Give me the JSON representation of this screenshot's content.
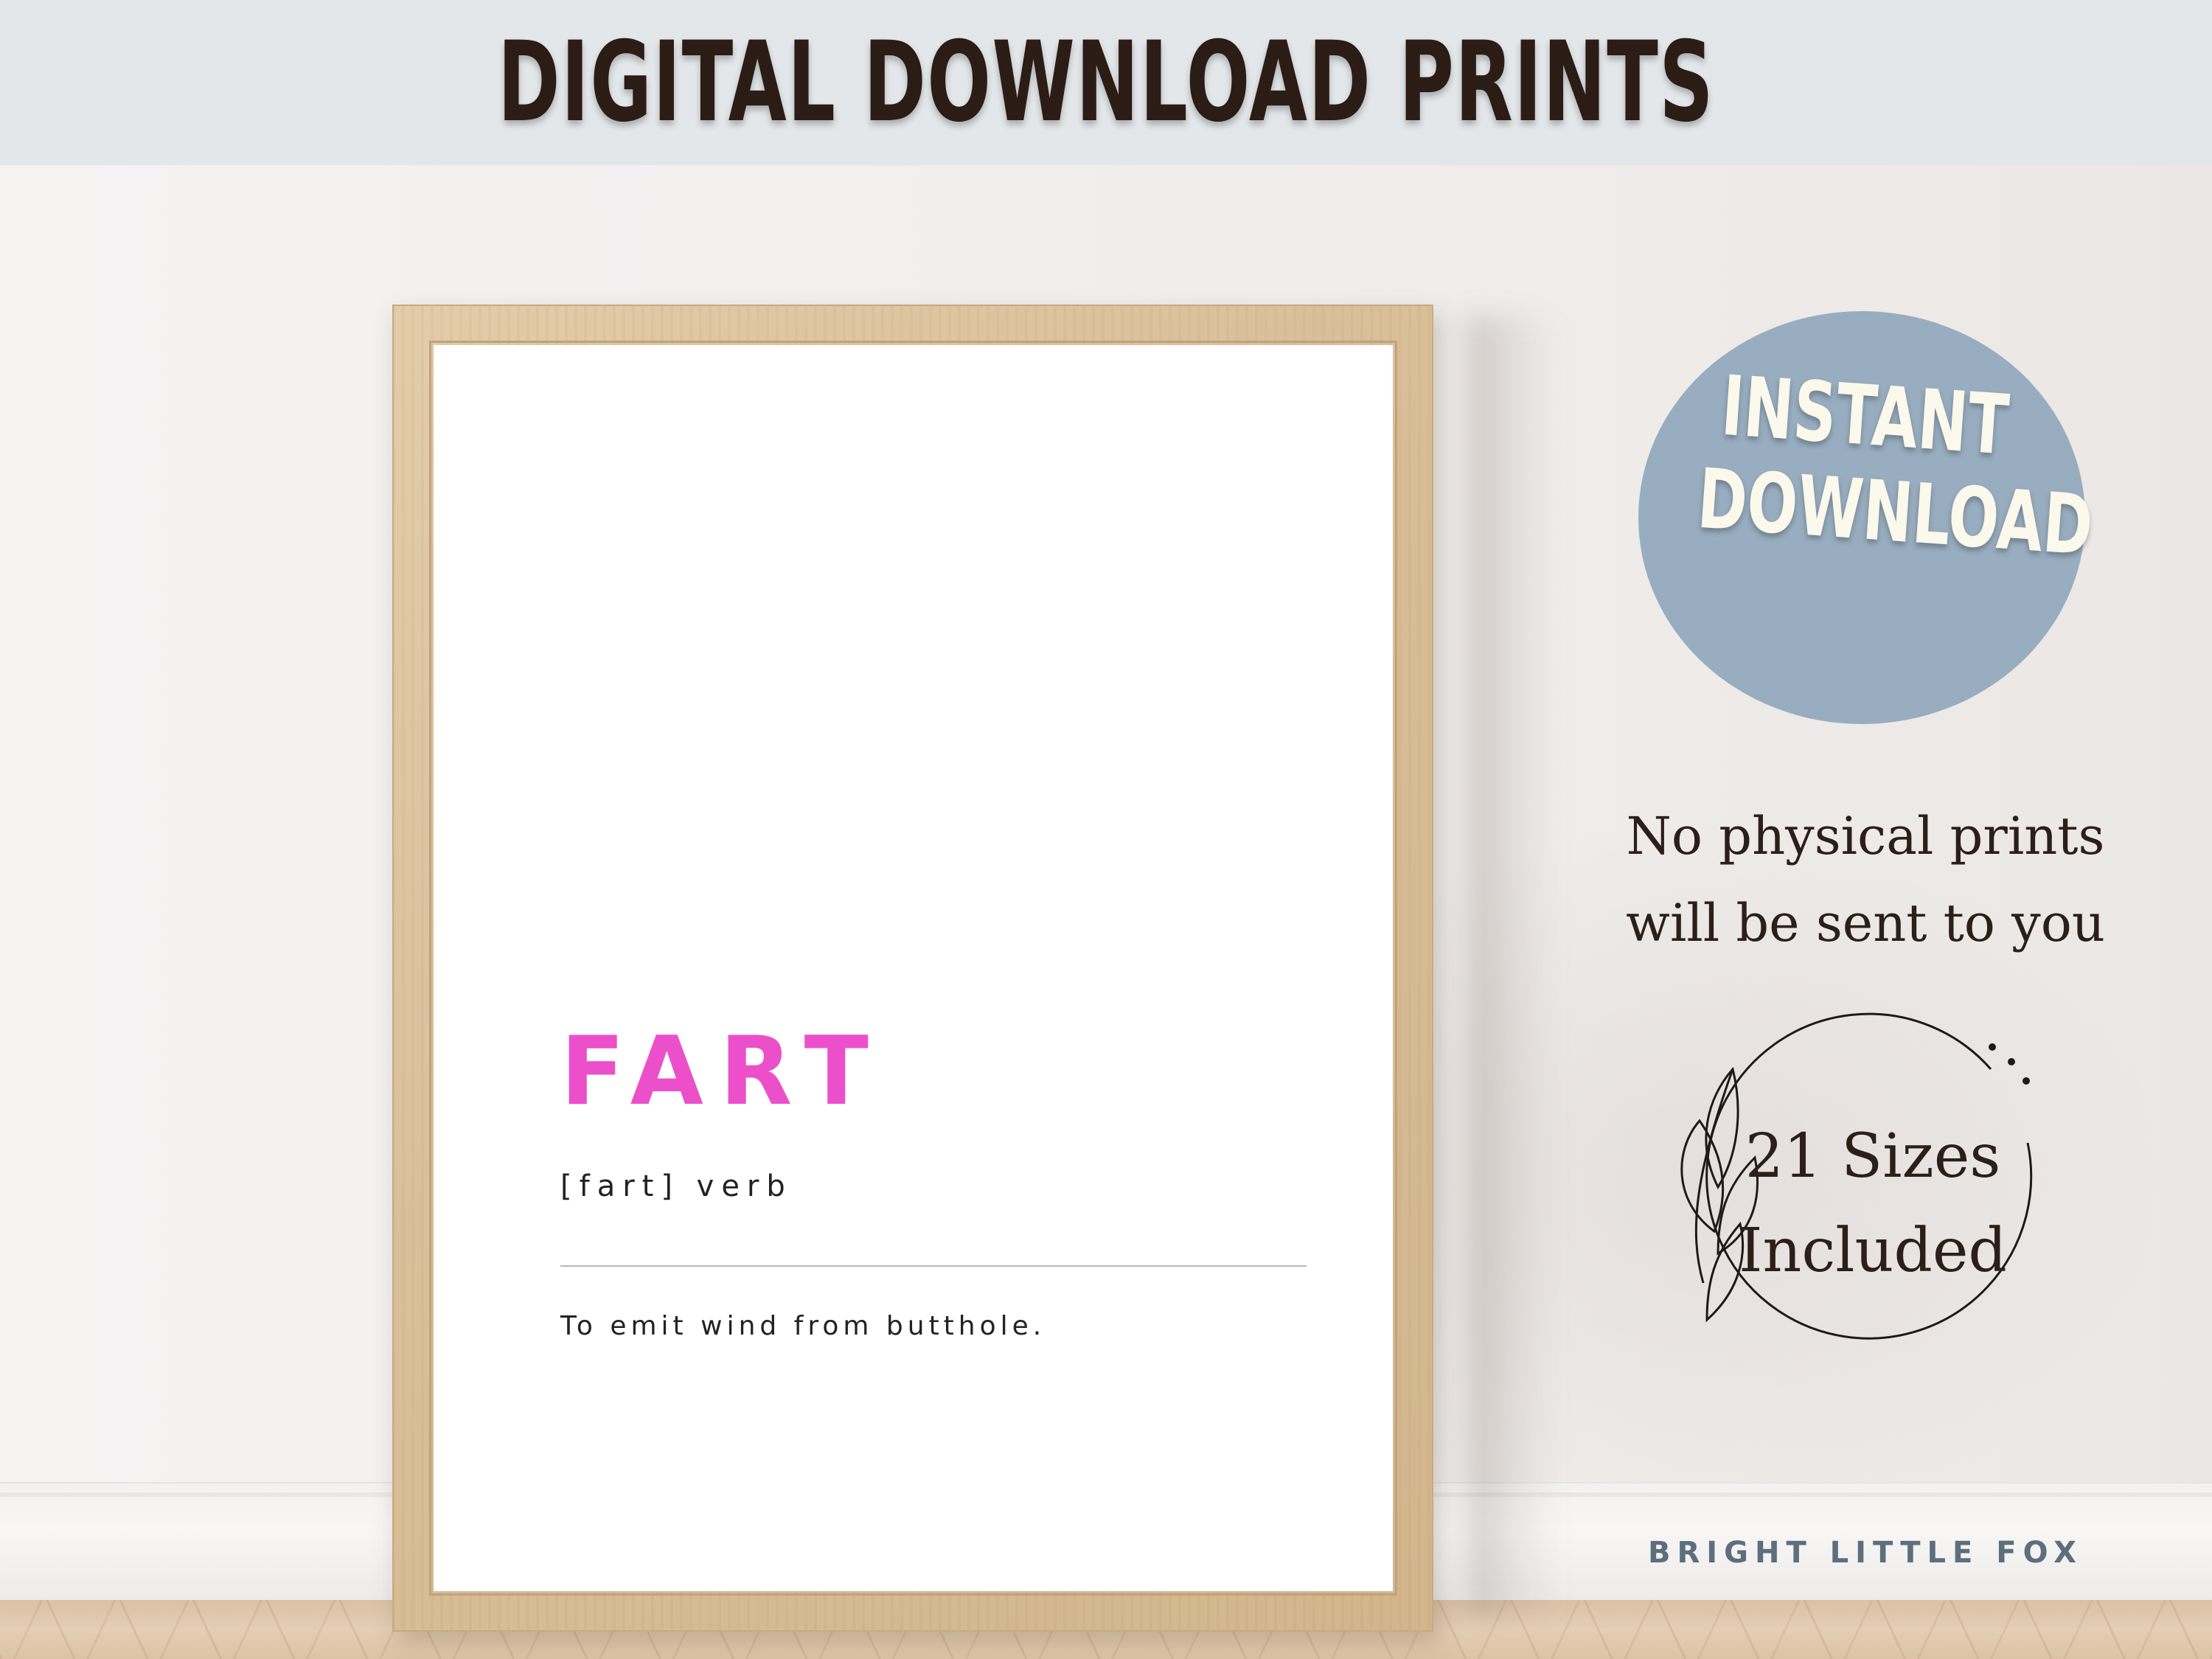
{
  "banner": {
    "title": "DIGITAL DOWNLOAD PRINTS"
  },
  "print": {
    "word": "FART",
    "pronunciation": "[fart] verb",
    "definition": "To emit wind from butthole."
  },
  "badge": {
    "line1": "INSTANT",
    "line2": "DOWNLOAD"
  },
  "notice": {
    "line1": "No physical prints",
    "line2": "will be sent to you"
  },
  "sizes": {
    "line1": "21 Sizes",
    "line2": "Included"
  },
  "brand": {
    "name": "BRIGHT LITTLE FOX"
  },
  "colors": {
    "banner_bg": "#e3e7ea",
    "banner_text": "#2b1c15",
    "word_pink": "#ec4fca",
    "badge_blue": "#98adbf",
    "badge_text": "#fbf8ec",
    "brand_text": "#5d6e7c"
  }
}
